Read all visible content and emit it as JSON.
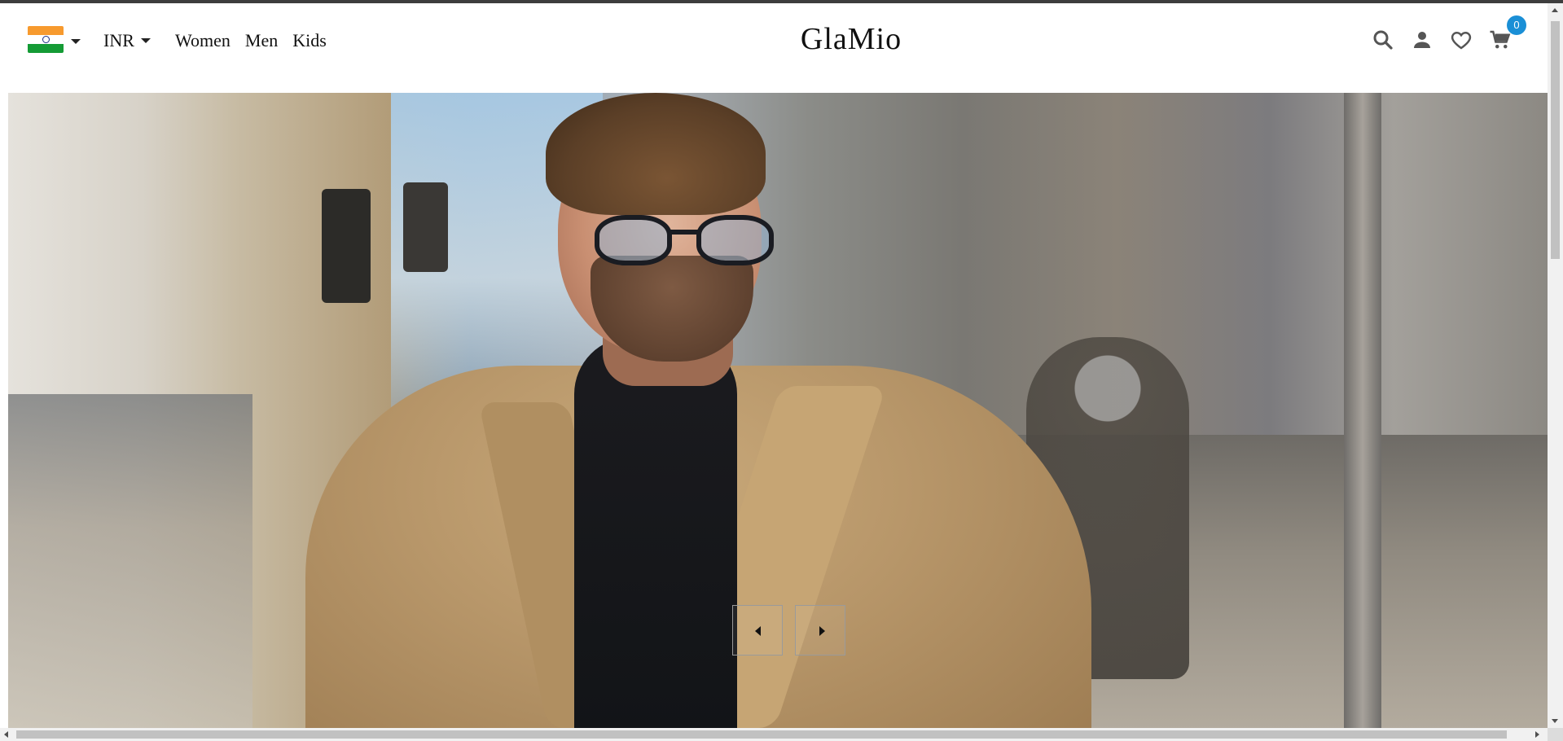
{
  "header": {
    "country_flag": "india-flag-icon",
    "currency": "INR",
    "nav": [
      "Women",
      "Men",
      "Kids"
    ],
    "logo": "GlaMio",
    "icons": [
      "search-icon",
      "account-icon",
      "wishlist-heart-icon",
      "cart-icon"
    ],
    "cart_count": "0"
  },
  "hero": {
    "image_subject": "hero-banner-man-in-camel-coat",
    "prev_icon": "caret-left-icon",
    "next_icon": "caret-right-icon"
  },
  "colors": {
    "badge": "#1a8fd6",
    "text": "#111111",
    "top_bar": "#3d3d3d"
  }
}
